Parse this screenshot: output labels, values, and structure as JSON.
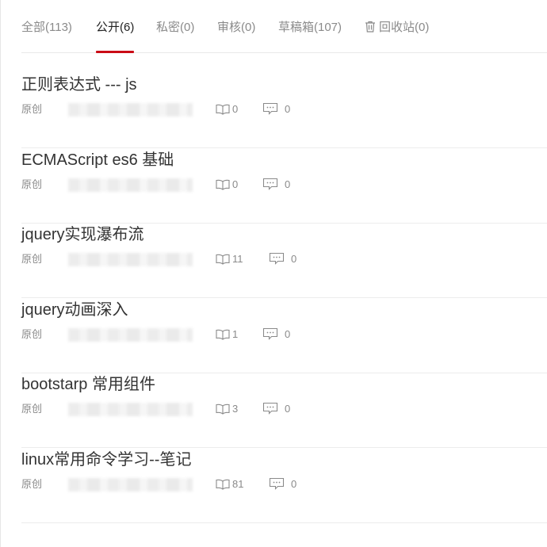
{
  "tabs": [
    {
      "label": "全部(113)"
    },
    {
      "label": "公开(6)"
    },
    {
      "label": "私密(0)"
    },
    {
      "label": "审核(0)"
    },
    {
      "label": "草稿箱(107)"
    },
    {
      "label": "回收站(0)",
      "icon": "trash-icon"
    }
  ],
  "active_tab": "公开(6)",
  "accent_color": "#ca0c16",
  "articles": [
    {
      "title": "正则表达式 --- js",
      "type": "原创",
      "reads": "0",
      "comments": "0"
    },
    {
      "title": "ECMAScript es6 基础",
      "type": "原创",
      "reads": "0",
      "comments": "0"
    },
    {
      "title": "jquery实现瀑布流",
      "type": "原创",
      "reads": "11",
      "comments": "0"
    },
    {
      "title": "jquery动画深入",
      "type": "原创",
      "reads": "1",
      "comments": "0"
    },
    {
      "title": "bootstarp 常用组件",
      "type": "原创",
      "reads": "3",
      "comments": "0"
    },
    {
      "title": "linux常用命令学习--笔记",
      "type": "原创",
      "reads": "81",
      "comments": "0"
    }
  ],
  "icons": {
    "reads": "book-icon",
    "comments": "comment-icon"
  }
}
